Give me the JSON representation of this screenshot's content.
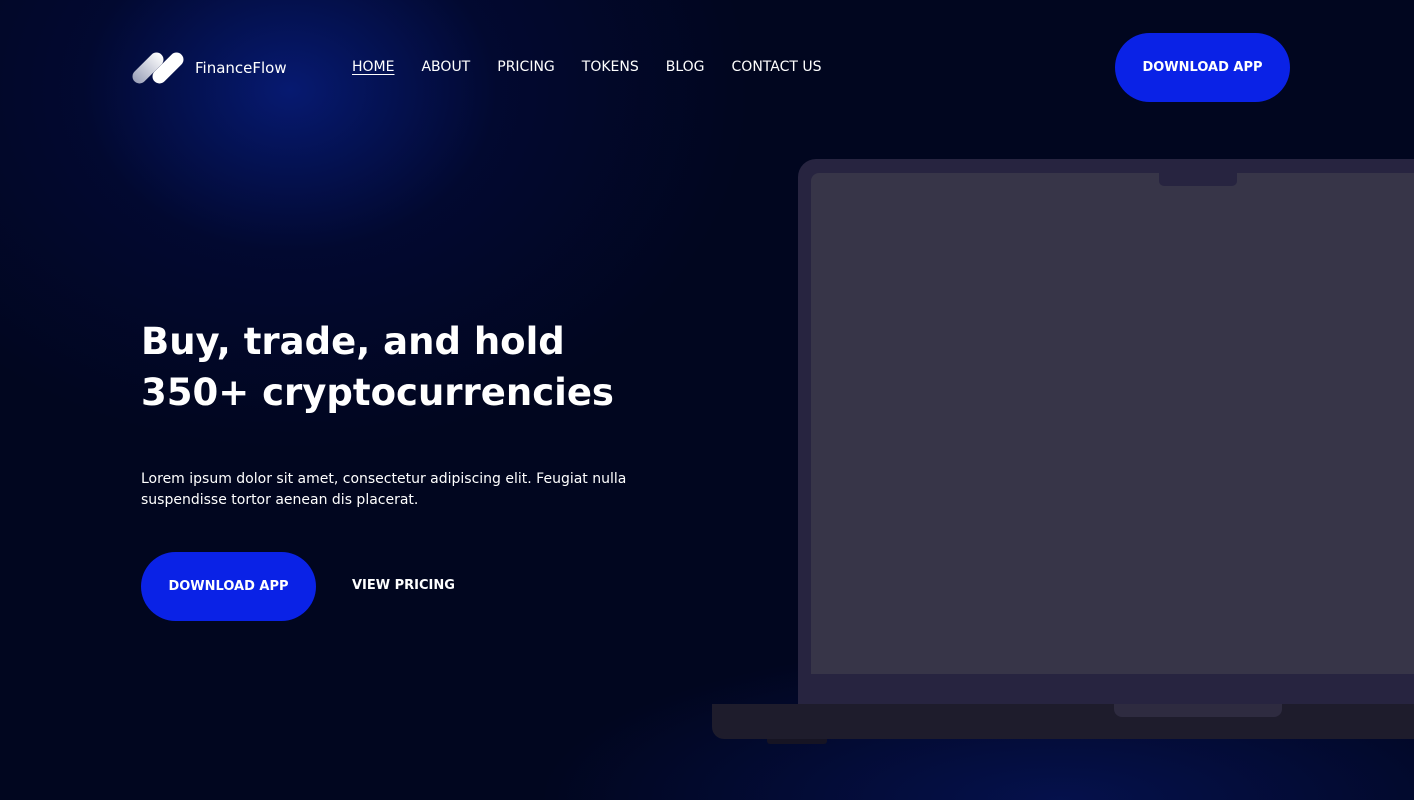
{
  "header": {
    "brand": "FinanceFlow",
    "nav": [
      {
        "label": "HOME",
        "active": true
      },
      {
        "label": "ABOUT",
        "active": false
      },
      {
        "label": "PRICING",
        "active": false
      },
      {
        "label": "TOKENS",
        "active": false
      },
      {
        "label": "BLOG",
        "active": false
      },
      {
        "label": "CONTACT US",
        "active": false
      }
    ],
    "cta_label": "DOWNLOAD APP"
  },
  "hero": {
    "title": "Buy, trade, and hold 350+ cryptocurrencies",
    "description": "Lorem ipsum dolor sit amet, consectetur adipiscing elit. Feugiat nulla suspendisse tortor aenean dis placerat.",
    "primary_cta": "DOWNLOAD APP",
    "secondary_cta": "VIEW PRICING"
  },
  "colors": {
    "background": "#01061f",
    "accent": "#0a22e6",
    "text": "#ffffff",
    "laptop_frame": "#272440",
    "laptop_screen": "#373548"
  },
  "icons": {
    "logo": "financeflow-logo-icon"
  }
}
